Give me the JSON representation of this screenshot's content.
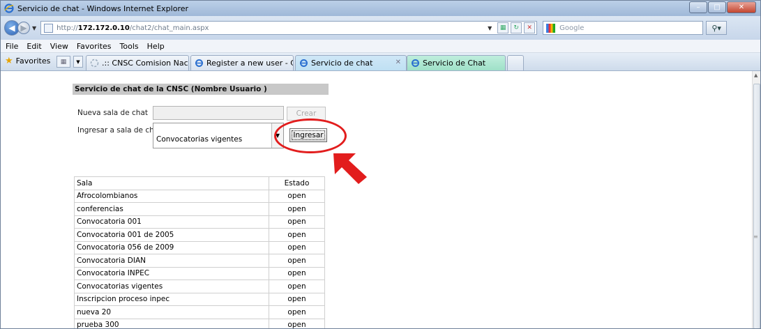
{
  "window": {
    "title": "Servicio de chat - Windows Internet Explorer"
  },
  "address": {
    "url_prefix": "http://",
    "url_host": "172.172.0.10",
    "url_path": "/chat2/chat_main.aspx",
    "search_placeholder": "Google"
  },
  "menu": [
    "File",
    "Edit",
    "View",
    "Favorites",
    "Tools",
    "Help"
  ],
  "favorites_label": "Favorites",
  "tabs": [
    {
      "label": ".:: CNSC Comision Nacion..."
    },
    {
      "label": "Register a new user - CNSC"
    },
    {
      "label": "Servicio de chat"
    },
    {
      "label": "Servicio de Chat"
    }
  ],
  "page": {
    "header": "Servicio de chat de la CNSC (Nombre Usuario )",
    "new_room_label": "Nueva sala de chat",
    "create_button": "Crear",
    "enter_room_label": "Ingresar a sala de chat",
    "selected_room": "Convocatorias vigentes",
    "enter_button": "Ingresar",
    "table": {
      "headers": [
        "Sala",
        "Estado"
      ],
      "rows": [
        [
          "Afrocolombianos",
          "open"
        ],
        [
          "conferencias",
          "open"
        ],
        [
          "Convocatoria 001",
          "open"
        ],
        [
          "Convocatoria 001 de 2005",
          "open"
        ],
        [
          "Convocatoria 056 de 2009",
          "open"
        ],
        [
          "Convocatoria DIAN",
          "open"
        ],
        [
          "Convocatoria INPEC",
          "open"
        ],
        [
          "Convocatorias vigentes",
          "open"
        ],
        [
          "Inscripcion proceso inpec",
          "open"
        ],
        [
          "nueva 20",
          "open"
        ],
        [
          "prueba 300",
          "open"
        ]
      ]
    }
  },
  "colors": {
    "highlight": "#e21d1d",
    "header_bg": "#c8c8c8"
  }
}
